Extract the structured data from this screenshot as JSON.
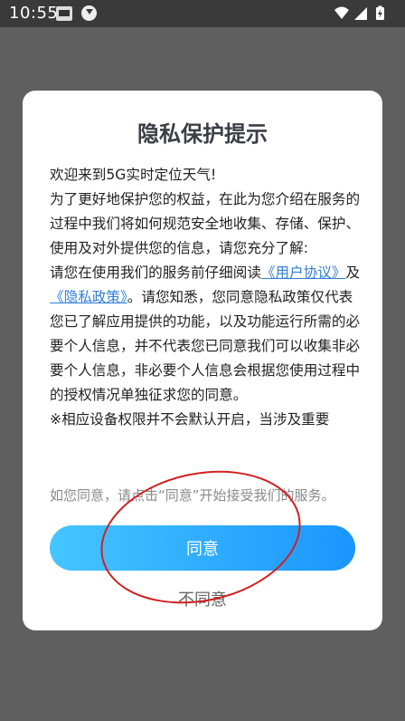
{
  "status_bar": {
    "time": "10:55",
    "icons": [
      "news-app-icon",
      "download-icon",
      "wifi-icon",
      "signal-icon",
      "battery-charging-icon"
    ]
  },
  "dialog": {
    "title": "隐私保护提示",
    "para1": "欢迎来到5G实时定位天气!\n为了更好地保护您的权益，在此为您介绍在服务的过程中我们将如何规范安全地收集、存储、保护、使用及对外提供您的信息，请您充分了解:\n请您在使用我们的服务前仔细阅读",
    "user_agreement_link": "《用户协议》",
    "and_text": "及",
    "privacy_policy_link": "《隐私政策》",
    "para2": "。请您知悉，您同意隐私政策仅代表您已了解应用提供的功能，以及功能运行所需的必要个人信息，并不代表您已同意我们可以收集非必要个人信息，非必要个人信息会根据您使用过程中的授权情况单独征求您的同意。\n※相应设备权限并不会默认开启，当涉及重要",
    "hint": "如您同意，请点击“同意”开始接受我们的服务。",
    "agree_label": "同意",
    "disagree_label": "不同意"
  },
  "colors": {
    "accent_gradient_start": "#45c6ff",
    "accent_gradient_end": "#1b95ff",
    "link": "#2f7fd6",
    "annotation": "#d21f1f"
  }
}
